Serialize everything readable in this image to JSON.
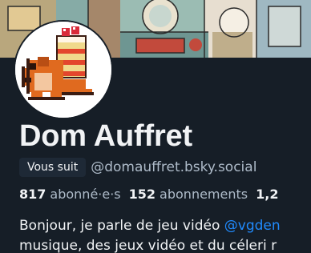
{
  "profile": {
    "display_name": "Dom Auffret",
    "follows_you_label": "Vous suit",
    "handle": "@domauffret.bsky.social"
  },
  "stats": {
    "followers_count": "817",
    "followers_label": "abonné·e·s",
    "following_count": "152",
    "following_label": "abonnements",
    "posts_count": "1,2"
  },
  "bio": {
    "line1_text": "Bonjour, je parle de jeu vidéo ",
    "line1_mention": "@vgden",
    "line2_text": "musique, des jeux vidéo et du céleri r"
  },
  "colors": {
    "background": "#161e27",
    "text_primary": "#f1f3f5",
    "text_secondary": "#aebbc9",
    "badge_bg": "#1e2936",
    "link": "#208bfe"
  }
}
